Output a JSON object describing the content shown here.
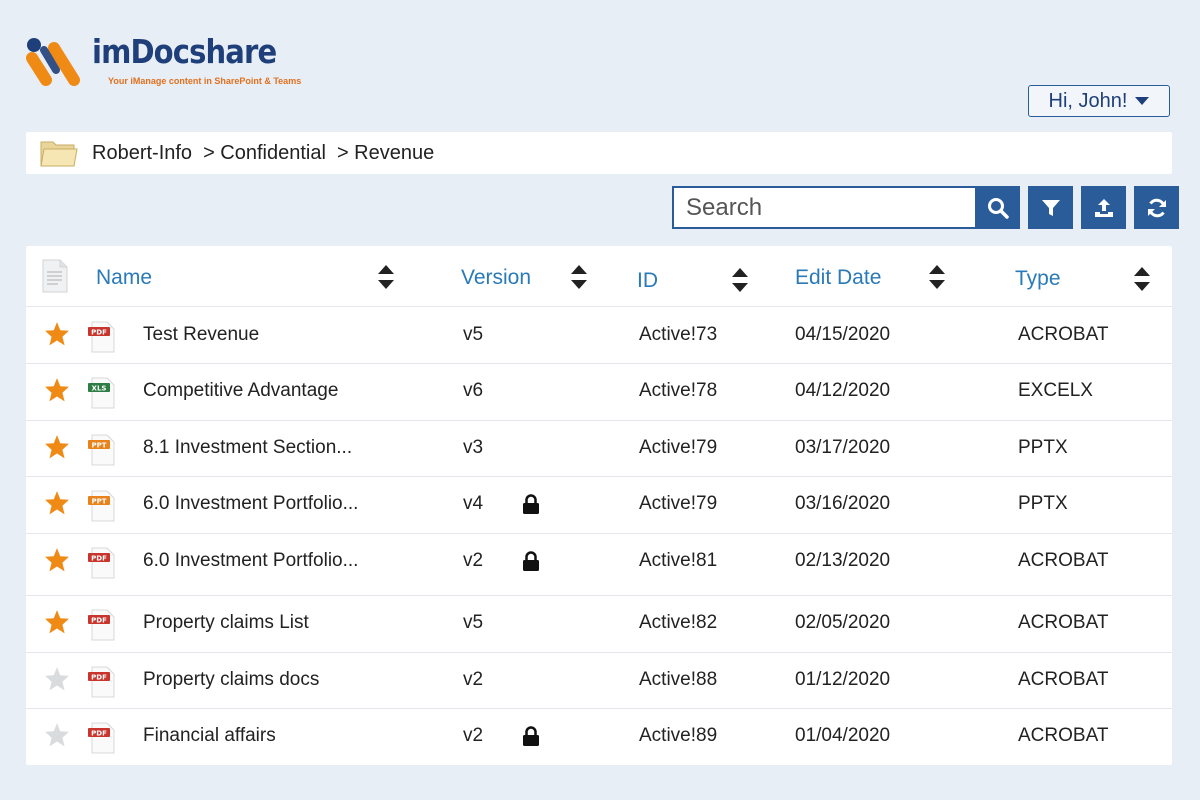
{
  "brand": {
    "name": "imDocshare",
    "tagline": "Your iManage content in SharePoint & Teams"
  },
  "user": {
    "greeting": "Hi, John!"
  },
  "breadcrumb": {
    "icon": "folder-icon",
    "items": [
      "Robert-Info",
      "> Confidential",
      "> Revenue"
    ]
  },
  "search": {
    "placeholder": "Search",
    "value": ""
  },
  "toolbar": {
    "buttons": [
      "search-icon",
      "filter-icon",
      "upload-icon",
      "refresh-icon"
    ]
  },
  "colors": {
    "accent": "#2b5c9a",
    "star_active": "#ef8a14",
    "star_inactive": "#d9dcdf",
    "link": "#2a7ab8",
    "background": "#e8eef5"
  },
  "table": {
    "columns": [
      "Name",
      "Version",
      "ID",
      "Edit Date",
      "Type"
    ],
    "rows": [
      {
        "starred": true,
        "file_icon": "PDF",
        "name": "Test Revenue",
        "version": "v5",
        "locked": false,
        "id": "Active!73",
        "date": "04/15/2020",
        "type": "ACROBAT"
      },
      {
        "starred": true,
        "file_icon": "XLS",
        "name": "Competitive Advantage",
        "version": "v6",
        "locked": false,
        "id": "Active!78",
        "date": "04/12/2020",
        "type": "EXCELX"
      },
      {
        "starred": true,
        "file_icon": "PPT",
        "name": "8.1 Investment Section...",
        "version": "v3",
        "locked": false,
        "id": "Active!79",
        "date": "03/17/2020",
        "type": "PPTX"
      },
      {
        "starred": true,
        "file_icon": "PPT",
        "name": "6.0 Investment Portfolio...",
        "version": "v4",
        "locked": true,
        "id": "Active!79",
        "date": "03/16/2020",
        "type": "PPTX"
      },
      {
        "starred": true,
        "file_icon": "PDF",
        "name": "6.0 Investment Portfolio...",
        "version": "v2",
        "locked": true,
        "id": "Active!81",
        "date": "02/13/2020",
        "type": "ACROBAT"
      },
      {
        "starred": true,
        "file_icon": "PDF",
        "name": "Property claims List",
        "version": "v5",
        "locked": false,
        "id": "Active!82",
        "date": "02/05/2020",
        "type": "ACROBAT"
      },
      {
        "starred": false,
        "file_icon": "PDF",
        "name": "Property claims docs",
        "version": "v2",
        "locked": false,
        "id": "Active!88",
        "date": "01/12/2020",
        "type": "ACROBAT"
      },
      {
        "starred": false,
        "file_icon": "PDF",
        "name": "Financial affairs",
        "version": "v2",
        "locked": true,
        "id": "Active!89",
        "date": "01/04/2020",
        "type": "ACROBAT"
      }
    ]
  }
}
